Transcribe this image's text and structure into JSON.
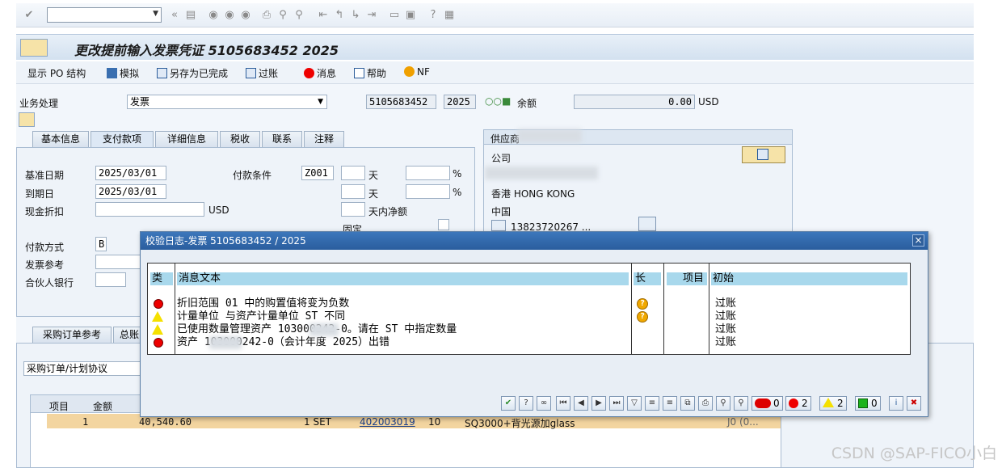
{
  "systoolbar": {
    "command_value": ""
  },
  "title": {
    "text": "更改提前输入发票凭证 5105683452 2025"
  },
  "apptoolbar": {
    "po_structure": "显示 PO 结构",
    "simulate": "模拟",
    "save_complete": "另存为已完成",
    "post": "过账",
    "messages": "消息",
    "help": "帮助",
    "nf": "NF"
  },
  "header": {
    "transaction_label": "业务处理",
    "transaction_value": "发票",
    "doc_number": "5105683452",
    "year": "2025",
    "balance_label": "余额",
    "balance_value": "0.00",
    "currency": "USD"
  },
  "tabs": [
    "基本信息",
    "支付款项",
    "详细信息",
    "税收",
    "联系",
    "注释"
  ],
  "payment": {
    "baseline_label": "基准日期",
    "baseline_value": "2025/03/01",
    "due_label": "到期日",
    "due_value": "2025/03/01",
    "cash_discount_label": "现金折扣",
    "cash_discount_currency": "USD",
    "terms_label": "付款条件",
    "terms_value": "Z001",
    "days1": "天",
    "pct1": "%",
    "days2": "天",
    "pct2": "%",
    "net_days": "天内净额",
    "fixed": "固定",
    "method_label": "付款方式",
    "method_value": "B",
    "ref_label": "发票参考",
    "bank_label": "合伙人银行"
  },
  "vendor": {
    "header": "供应商",
    "company_label": "公司",
    "city": "香港 HONG KONG",
    "country": "中国",
    "phone": "13823720267 ..."
  },
  "lower_tabs": [
    "采购订单参考",
    "总账"
  ],
  "lower": {
    "ref_type": "采购订单/计划协议",
    "col_item": "项目",
    "col_amount": "金额",
    "row": {
      "item": "1",
      "amount": "40,540.60",
      "qty": "1 SET",
      "po": "402003019",
      "po_item": "10",
      "text": "SQ3000+背光源加glass",
      "tail": "J0 (0..."
    }
  },
  "dialog": {
    "title": "校验日志-发票 5105683452 / 2025",
    "headers": {
      "type": "类",
      "text": "消息文本",
      "long": "长",
      "item": "项目",
      "origin": "初始"
    },
    "rows": [
      {
        "signal": "error",
        "text": "折旧范围 01 中的购置值将变为负数",
        "help": true,
        "origin": "过账"
      },
      {
        "signal": "warning",
        "text": "计量单位   与资产计量单位 ST 不同",
        "help": true,
        "origin": "过账"
      },
      {
        "signal": "warning",
        "text": "已使用数量管理资产      103000242-0。请在 ST 中指定数量",
        "help": false,
        "origin": "过账"
      },
      {
        "signal": "error",
        "text": "资产       103000242-0（会计年度 2025）出错",
        "help": false,
        "origin": "过账"
      }
    ],
    "counts": {
      "stop": "0",
      "error": "2",
      "warning": "2",
      "success": "0"
    }
  },
  "watermark": "CSDN @SAP-FICO小白"
}
